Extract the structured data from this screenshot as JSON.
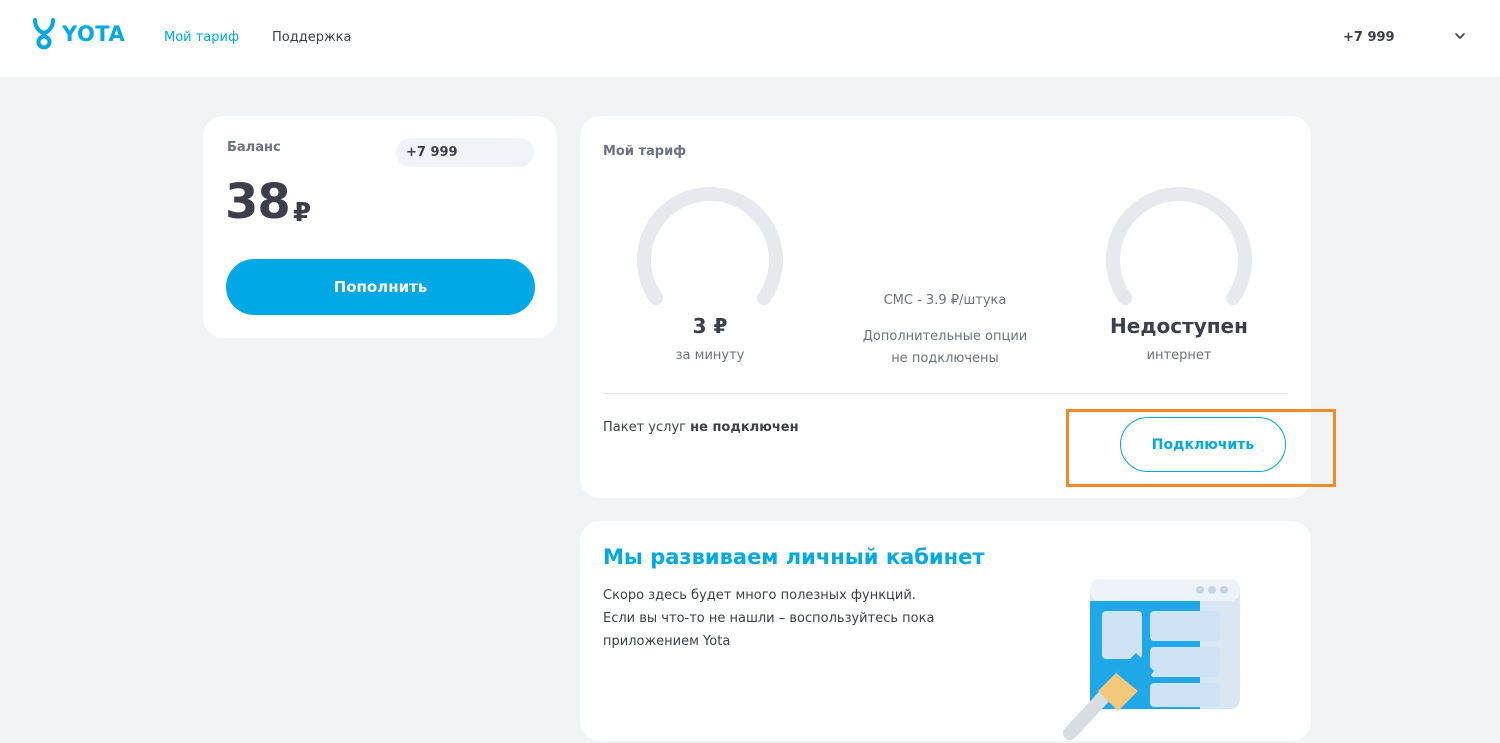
{
  "header": {
    "logo_text": "YOTA",
    "nav": {
      "tariff": "Мой тариф",
      "support": "Поддержка"
    },
    "account_phone": "+7 999"
  },
  "balance": {
    "label": "Баланс",
    "phone": "+7 999",
    "amount": "38",
    "currency": "₽",
    "topup_label": "Пополнить"
  },
  "tariff": {
    "title": "Мой тариф",
    "minute_price": "3 ₽",
    "minute_sub": "за минуту",
    "sms": "СМС - 3.9 ₽/штука",
    "options_line1": "Дополнительные опции",
    "options_line2": "не подключены",
    "internet_value": "Недоступен",
    "internet_sub": "интернет",
    "package_prefix": "Пакет услуг",
    "package_status": "не подключен",
    "connect_label": "Подключить"
  },
  "promo": {
    "title": "Мы развиваем личный кабинет",
    "lines": [
      "Скоро здесь будет много полезных функций.",
      "Если вы что-то не нашли – воспользуйтесь пока",
      "приложением Yota"
    ]
  },
  "colors": {
    "accent": "#00a8e6",
    "background": "#f2f3f5",
    "highlight": "#f08a24",
    "text": "#3a3f4b",
    "muted": "#6b7280"
  }
}
